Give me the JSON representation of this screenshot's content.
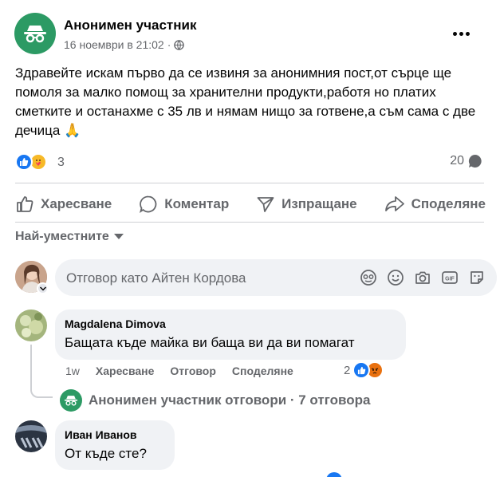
{
  "post": {
    "author": "Анонимен участник",
    "date": "16 ноември в 21:02",
    "separator": "·",
    "text": "Здравейте искам първо да се извиня за анонимния пост,от сърце ще помоля за малко помощ за хранителни продукти,работя но платих сметките и останахме с 35 лв и нямам нищо за готвене,а съм сама с две дечица 🙏",
    "reactions_count": "3",
    "comments_count": "20",
    "icons": [
      "incognito-icon",
      "globe-icon",
      "more-dots-icon"
    ]
  },
  "actions": {
    "like": "Харесване",
    "comment": "Коментар",
    "send": "Изпращане",
    "share": "Споделяне"
  },
  "sort": {
    "label": "Най-уместните"
  },
  "reply_box": {
    "placeholder": "Отговор като Айтен Кордова"
  },
  "comments": [
    {
      "author": "Magdalena Dimova",
      "text": "Бащата къде майка ви баща ви да ви помагат",
      "time": "1w",
      "like": "Харесване",
      "reply": "Отговор",
      "share": "Споделяне",
      "reactions_count": "2"
    },
    {
      "author": "Иван Иванов",
      "text": "От къде сте?"
    }
  ],
  "replies_link": {
    "text": "Анонимен участник отговори · 7 отговора"
  },
  "colors": {
    "accent": "#1877f2",
    "anon": "#2c9a64",
    "secondary_text": "#65676b",
    "bubble": "#f0f2f5"
  }
}
